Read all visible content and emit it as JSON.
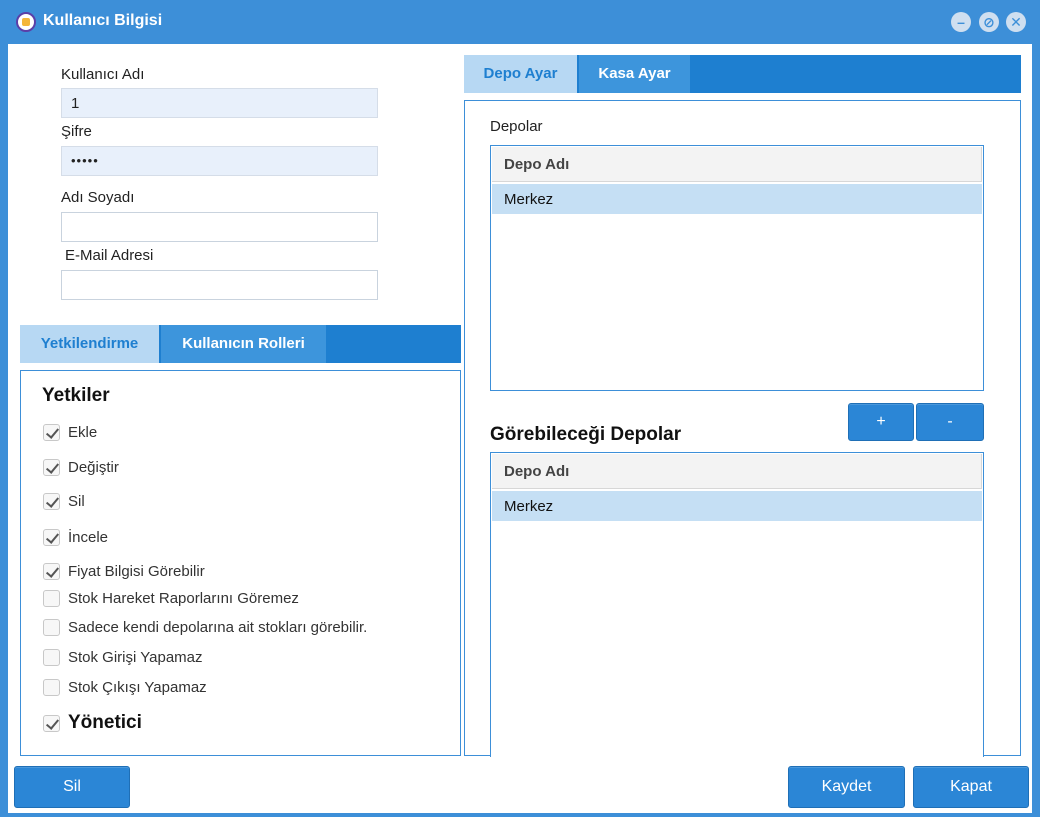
{
  "window": {
    "title": "Kullanıcı Bilgisi",
    "controls": [
      "minimize-icon",
      "restore-icon",
      "close-icon"
    ]
  },
  "form": {
    "username_label": "Kullanıcı Adı",
    "username_value": "1",
    "password_label": "Şifre",
    "password_value": "•••••",
    "fullname_label": "Adı Soyadı",
    "fullname_value": "",
    "email_label": "E-Mail Adresi",
    "email_value": ""
  },
  "left_tabs": [
    {
      "label": "Yetkilendirme",
      "active": true
    },
    {
      "label": "Kullanıcın Rolleri",
      "active": false
    }
  ],
  "permissions": {
    "title": "Yetkiler",
    "items": [
      {
        "label": "Ekle",
        "checked": true
      },
      {
        "label": "Değiştir",
        "checked": true
      },
      {
        "label": "Sil",
        "checked": true
      },
      {
        "label": "İncele",
        "checked": true
      },
      {
        "label": "Fiyat Bilgisi Görebilir",
        "checked": true
      },
      {
        "label": "Stok Hareket Raporlarını Göremez",
        "checked": false
      },
      {
        "label": "Sadece kendi depolarına ait stokları görebilir.",
        "checked": false
      },
      {
        "label": "Stok Girişi Yapamaz",
        "checked": false
      },
      {
        "label": "Stok Çıkışı Yapamaz",
        "checked": false
      }
    ],
    "admin": {
      "label": "Yönetici",
      "checked": true
    }
  },
  "right_tabs": [
    {
      "label": "Depo Ayar",
      "active": true
    },
    {
      "label": "Kasa Ayar",
      "active": false
    }
  ],
  "warehouses": {
    "label": "Depolar",
    "column": "Depo Adı",
    "rows": [
      "Merkez"
    ]
  },
  "visible_warehouses": {
    "title": "Görebileceği Depolar",
    "column": "Depo Adı",
    "rows": [
      "Merkez"
    ],
    "add_label": "+",
    "remove_label": "-"
  },
  "footer": {
    "delete_label": "Sil",
    "save_label": "Kaydet",
    "close_label": "Kapat"
  },
  "colors": {
    "primary": "#3d8fd8",
    "tab_bar": "#1e7fd0",
    "selected_row": "#c5dff4",
    "input_filled": "#e8f0fb"
  }
}
